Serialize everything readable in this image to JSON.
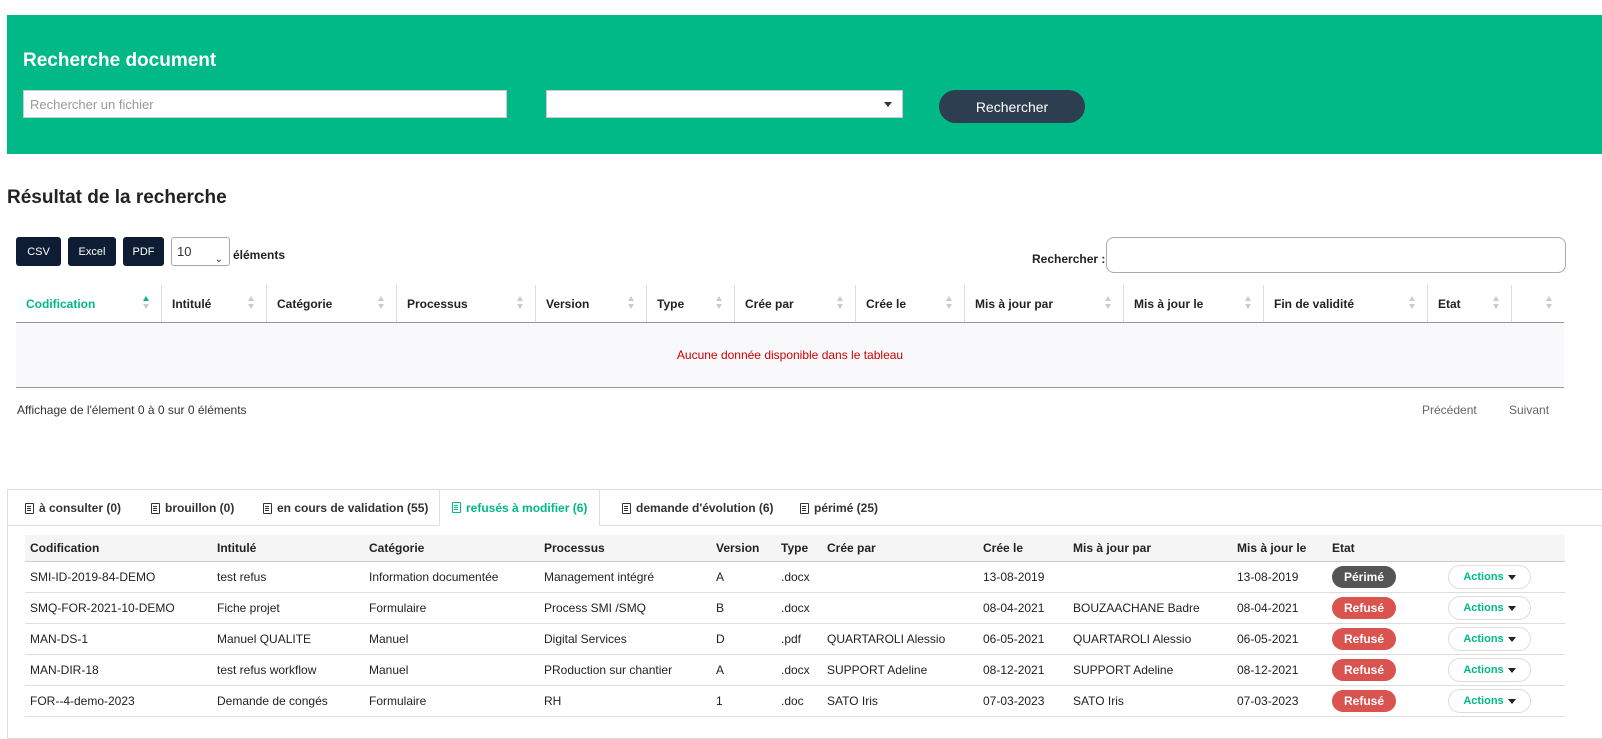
{
  "header": {
    "title": "Recherche document",
    "search_placeholder": "Rechercher un fichier",
    "select_value": "",
    "search_button": "Rechercher",
    "bg_color": "#00b987"
  },
  "results": {
    "title": "Résultat de la recherche",
    "export_buttons": [
      "CSV",
      "Excel",
      "PDF"
    ],
    "page_length": "10",
    "page_length_label": "éléments",
    "filter_label": "Rechercher :",
    "columns": [
      "Codification",
      "Intitulé",
      "Catégorie",
      "Processus",
      "Version",
      "Type",
      "Crée par",
      "Crée le",
      "Mis à jour par",
      "Mis à jour le",
      "Fin de validité",
      "Etat",
      ""
    ],
    "sorted_column": "Codification",
    "empty_message": "Aucune donnée disponible dans le tableau",
    "info": "Affichage de l'élement 0 à 0 sur 0 éléments",
    "prev": "Précédent",
    "next": "Suivant"
  },
  "tabs": [
    {
      "label": "à consulter (0)",
      "icon": "document-icon",
      "active": false
    },
    {
      "label": "brouillon (0)",
      "icon": "document-icon",
      "active": false
    },
    {
      "label": "en cours de validation (55)",
      "icon": "document-icon",
      "active": false
    },
    {
      "label": "refusés à modifier (6)",
      "icon": "document-icon",
      "active": true
    },
    {
      "label": "demande d'évolution (6)",
      "icon": "document-icon",
      "active": false
    },
    {
      "label": "périmé (25)",
      "icon": "document-icon",
      "active": false
    }
  ],
  "grid": {
    "columns": [
      "Codification",
      "Intitulé",
      "Catégorie",
      "Processus",
      "Version",
      "Type",
      "Crée par",
      "Crée le",
      "Mis à jour par",
      "Mis à jour le",
      "Etat"
    ],
    "actions_label": "Actions",
    "rows": [
      {
        "cod": "SMI-ID-2019-84-DEMO",
        "intitule": "test refus",
        "categorie": "Information documentée",
        "processus": "Management intégré",
        "version": "A",
        "type": ".docx",
        "cree_par": "",
        "cree_le": "13-08-2019",
        "maj_par": "",
        "maj_le": "13-08-2019",
        "etat": "Périmé",
        "etat_kind": "perime"
      },
      {
        "cod": "SMQ-FOR-2021-10-DEMO",
        "intitule": "Fiche projet",
        "categorie": "Formulaire",
        "processus": "Process SMI /SMQ",
        "version": "B",
        "type": ".docx",
        "cree_par": "",
        "cree_le": "08-04-2021",
        "maj_par": "BOUZAACHANE Badre",
        "maj_le": "08-04-2021",
        "etat": "Refusé",
        "etat_kind": "refuse"
      },
      {
        "cod": "MAN-DS-1",
        "intitule": "Manuel QUALITE",
        "categorie": "Manuel",
        "processus": "Digital Services",
        "version": "D",
        "type": ".pdf",
        "cree_par": "QUARTAROLI Alessio",
        "cree_le": "06-05-2021",
        "maj_par": "QUARTAROLI Alessio",
        "maj_le": "06-05-2021",
        "etat": "Refusé",
        "etat_kind": "refuse"
      },
      {
        "cod": "MAN-DIR-18",
        "intitule": "test refus workflow",
        "categorie": "Manuel",
        "processus": "PRoduction sur chantier",
        "version": "A",
        "type": ".docx",
        "cree_par": "SUPPORT Adeline",
        "cree_le": "08-12-2021",
        "maj_par": "SUPPORT Adeline",
        "maj_le": "08-12-2021",
        "etat": "Refusé",
        "etat_kind": "refuse"
      },
      {
        "cod": "FOR--4-demo-2023",
        "intitule": "Demande de congés",
        "categorie": "Formulaire",
        "processus": "RH",
        "version": "1",
        "type": ".doc",
        "cree_par": "SATO Iris",
        "cree_le": "07-03-2023",
        "maj_par": "SATO Iris",
        "maj_le": "07-03-2023",
        "etat": "Refusé",
        "etat_kind": "refuse"
      }
    ]
  }
}
